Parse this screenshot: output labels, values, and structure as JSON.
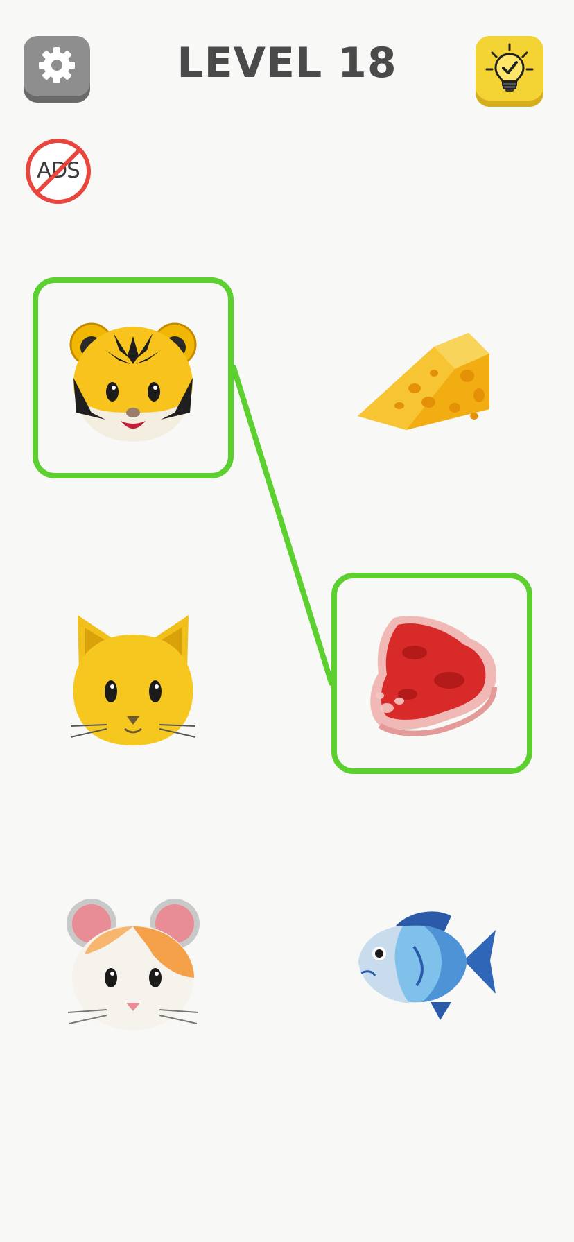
{
  "header": {
    "level_title": "LEVEL 18",
    "settings_icon": "gear-icon",
    "hint_icon": "lightbulb-check-icon"
  },
  "no_ads": {
    "label": "ADS",
    "icon": "no-ads-icon"
  },
  "colors": {
    "background": "#f8f8f6",
    "match_green": "#5bd02e",
    "settings_gray": "#8e8e8e",
    "hint_yellow": "#f4d335",
    "title_gray": "#4a4a4a",
    "no_ads_red": "#e8453c"
  },
  "board": {
    "left_column": [
      {
        "item": "tiger",
        "icon": "tiger-face-icon",
        "selected": true
      },
      {
        "item": "cat",
        "icon": "cat-face-icon",
        "selected": false
      },
      {
        "item": "hamster",
        "icon": "hamster-face-icon",
        "selected": false
      }
    ],
    "right_column": [
      {
        "item": "cheese",
        "icon": "cheese-wedge-icon",
        "selected": false
      },
      {
        "item": "meat",
        "icon": "meat-steak-icon",
        "selected": true
      },
      {
        "item": "fish",
        "icon": "fish-icon",
        "selected": false
      }
    ],
    "connections": [
      {
        "from": "tiger",
        "to": "meat"
      }
    ]
  }
}
